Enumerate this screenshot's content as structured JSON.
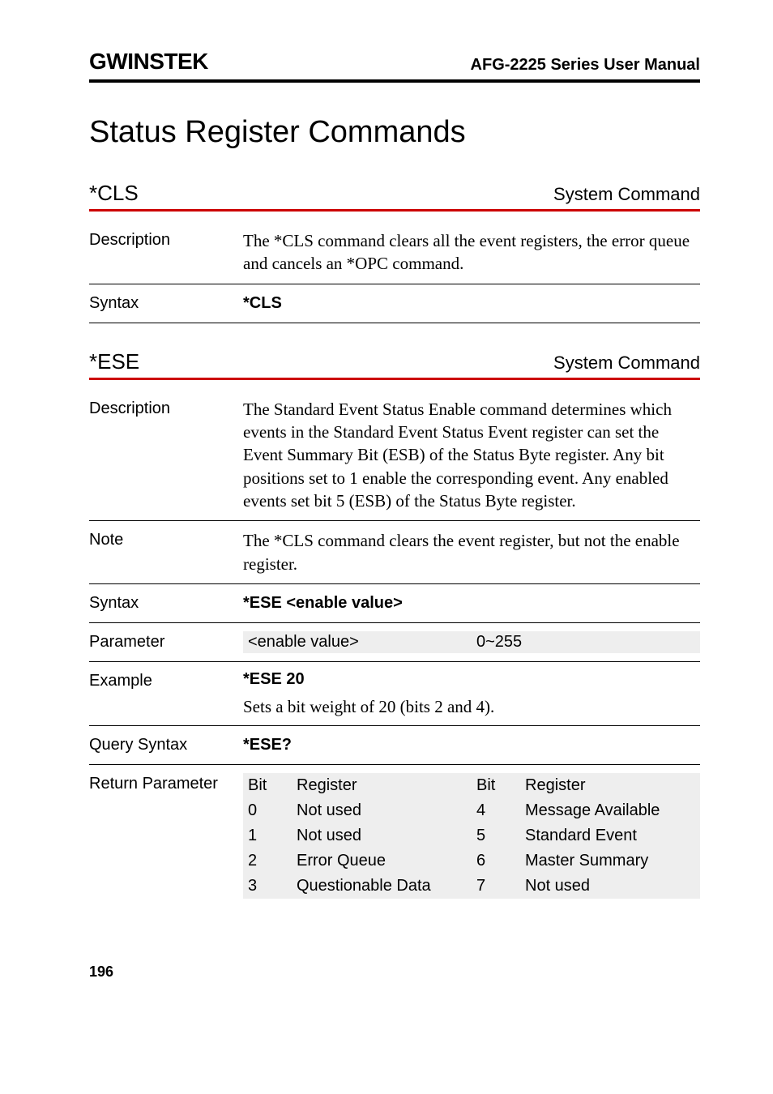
{
  "header": {
    "brand": "GWINSTEK",
    "docname": "AFG-2225 Series User Manual"
  },
  "page_title": "Status Register Commands",
  "cls": {
    "name": "*CLS",
    "type": "System Command",
    "description_label": "Description",
    "description": "The *CLS command clears all the event registers, the error queue and cancels an *OPC command.",
    "syntax_label": "Syntax",
    "syntax": "*CLS"
  },
  "ese": {
    "name": "*ESE",
    "type": "System Command",
    "description_label": "Description",
    "description": "The Standard Event Status Enable command determines which events in the Standard Event Status Event register can set the Event Summary Bit (ESB) of the Status Byte register. Any bit positions set to 1 enable the corresponding event. Any enabled events set bit 5 (ESB) of the Status Byte register.",
    "note_label": "Note",
    "note": "The *CLS command clears the event register, but not the enable register.",
    "syntax_label": "Syntax",
    "syntax": "*ESE <enable value>",
    "parameter_label": "Parameter",
    "parameter_name": "<enable value>",
    "parameter_range": "0~255",
    "example_label": "Example",
    "example_cmd": "*ESE 20",
    "example_desc": "Sets a bit weight of 20 (bits 2 and 4).",
    "query_label": "Query Syntax",
    "query": "*ESE?",
    "return_label": "Return Parameter",
    "bits": {
      "h1": "Bit",
      "h2": "Register",
      "h3": "Bit",
      "h4": "Register",
      "r0a": "0",
      "r0b": "Not used",
      "r0c": "4",
      "r0d": "Message Available",
      "r1a": "1",
      "r1b": "Not used",
      "r1c": "5",
      "r1d": "Standard Event",
      "r2a": "2",
      "r2b": "Error Queue",
      "r2c": "6",
      "r2d": "Master Summary",
      "r3a": "3",
      "r3b": "Questionable Data",
      "r3c": "7",
      "r3d": "Not used"
    }
  },
  "pagenum": "196"
}
